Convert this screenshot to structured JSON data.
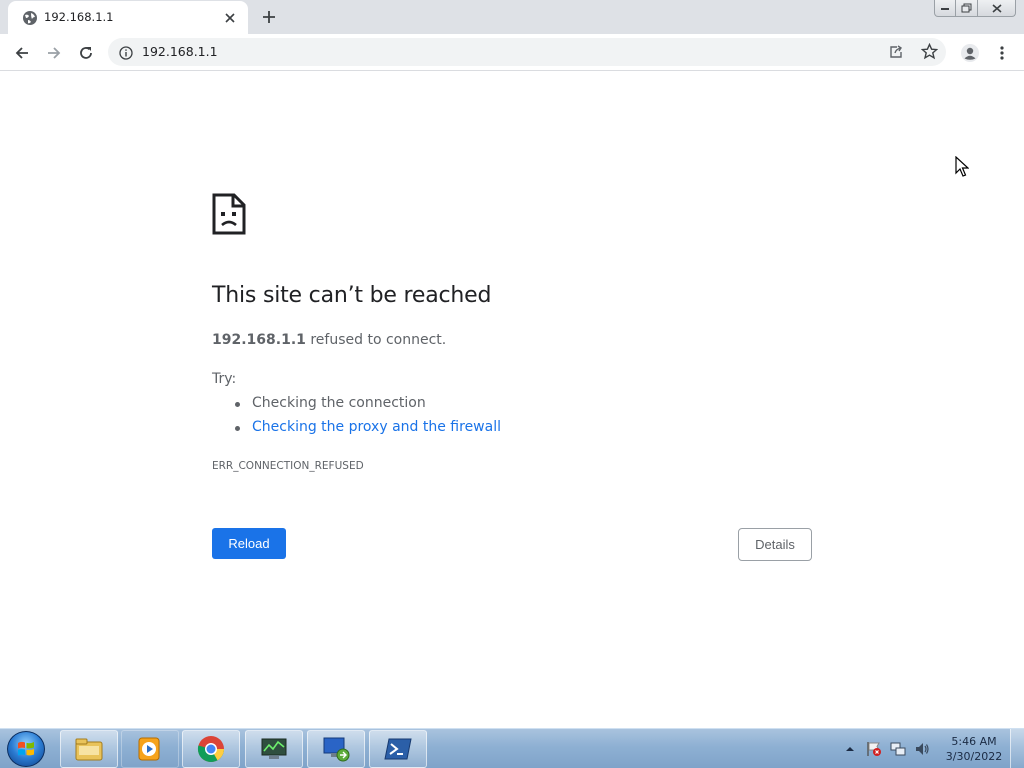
{
  "browser": {
    "tab": {
      "title": "192.168.1.1",
      "favicon": "globe-icon",
      "close_icon": "close-icon"
    },
    "new_tab_icon": "plus-icon",
    "window_controls": [
      "minimize-icon",
      "maximize-icon",
      "close-icon"
    ],
    "toolbar": {
      "back_icon": "back-arrow-icon",
      "forward_icon": "forward-arrow-icon",
      "reload_icon": "reload-icon",
      "site_info_icon": "info-icon",
      "url": "192.168.1.1",
      "share_icon": "share-icon",
      "bookmark_icon": "star-icon",
      "profile_icon": "profile-icon",
      "menu_icon": "kebab-menu-icon"
    }
  },
  "error_page": {
    "icon": "sad-page-icon",
    "headline": "This site can’t be reached",
    "host": "192.168.1.1",
    "summary_suffix": " refused to connect.",
    "try_label": "Try:",
    "suggestions": [
      {
        "text": "Checking the connection",
        "is_link": false
      },
      {
        "text": "Checking the proxy and the firewall",
        "is_link": true
      }
    ],
    "error_code": "ERR_CONNECTION_REFUSED",
    "reload_label": "Reload",
    "details_label": "Details"
  },
  "taskbar": {
    "start_icon": "windows-start-icon",
    "pinned": [
      "file-explorer-icon",
      "media-player-icon",
      "chrome-icon",
      "task-manager-icon",
      "remote-desktop-icon",
      "powershell-icon"
    ],
    "tray": [
      "show-hidden-icons-icon",
      "action-center-flag-icon",
      "network-icon",
      "volume-icon"
    ],
    "time": "5:46 AM",
    "date": "3/30/2022"
  },
  "colors": {
    "accent_blue": "#1a73e8",
    "text_primary": "#202124",
    "text_secondary": "#5f6368",
    "tabstrip": "#dee1e6"
  }
}
